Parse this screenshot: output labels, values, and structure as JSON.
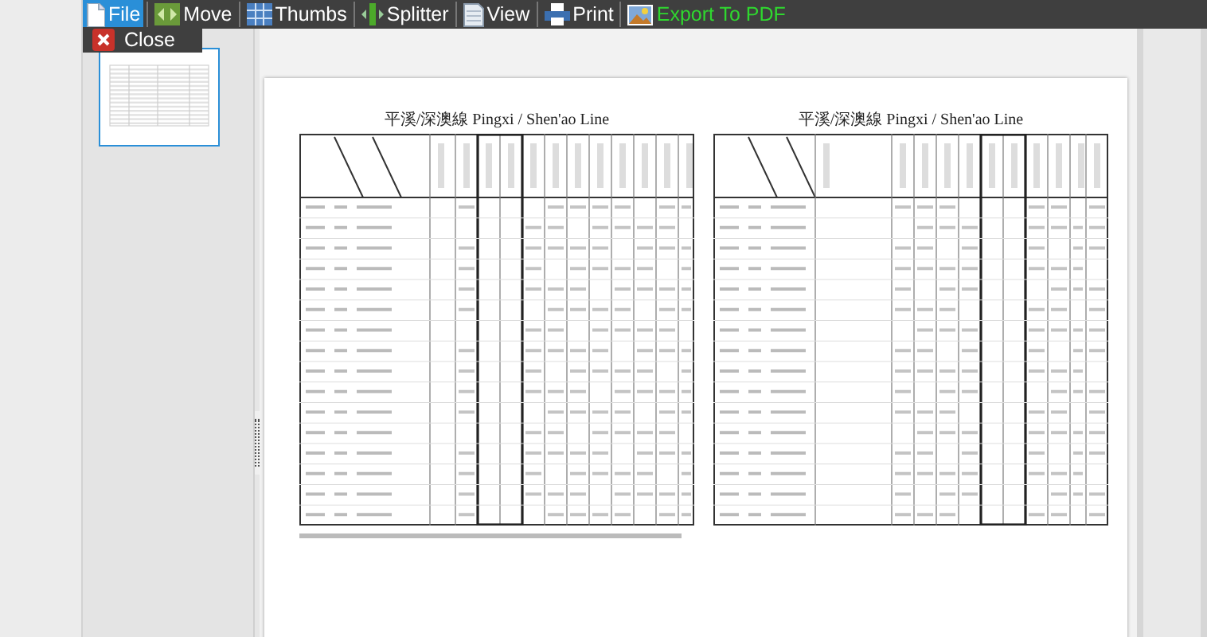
{
  "toolbar": [
    {
      "label": "File",
      "kind": "file",
      "selected": true
    },
    {
      "label": "Move",
      "kind": "move",
      "selected": false
    },
    {
      "label": "Thumbs",
      "kind": "thumbs",
      "selected": false
    },
    {
      "label": "Splitter",
      "kind": "splitter",
      "selected": false
    },
    {
      "label": "View",
      "kind": "view",
      "selected": false
    },
    {
      "label": "Print",
      "kind": "print",
      "selected": false
    },
    {
      "label": "Export To PDF",
      "kind": "export",
      "selected": false
    }
  ],
  "file_menu": {
    "expanded": true,
    "items": [
      {
        "label": "Close",
        "kind": "close"
      }
    ]
  },
  "thumbnails": [
    {
      "selected": true
    }
  ],
  "document": {
    "tables": [
      {
        "title": "平溪/深澳線 Pingxi / Shen'ao Line"
      },
      {
        "title": "平溪/深澳線 Pingxi / Shen'ao Line"
      }
    ]
  }
}
